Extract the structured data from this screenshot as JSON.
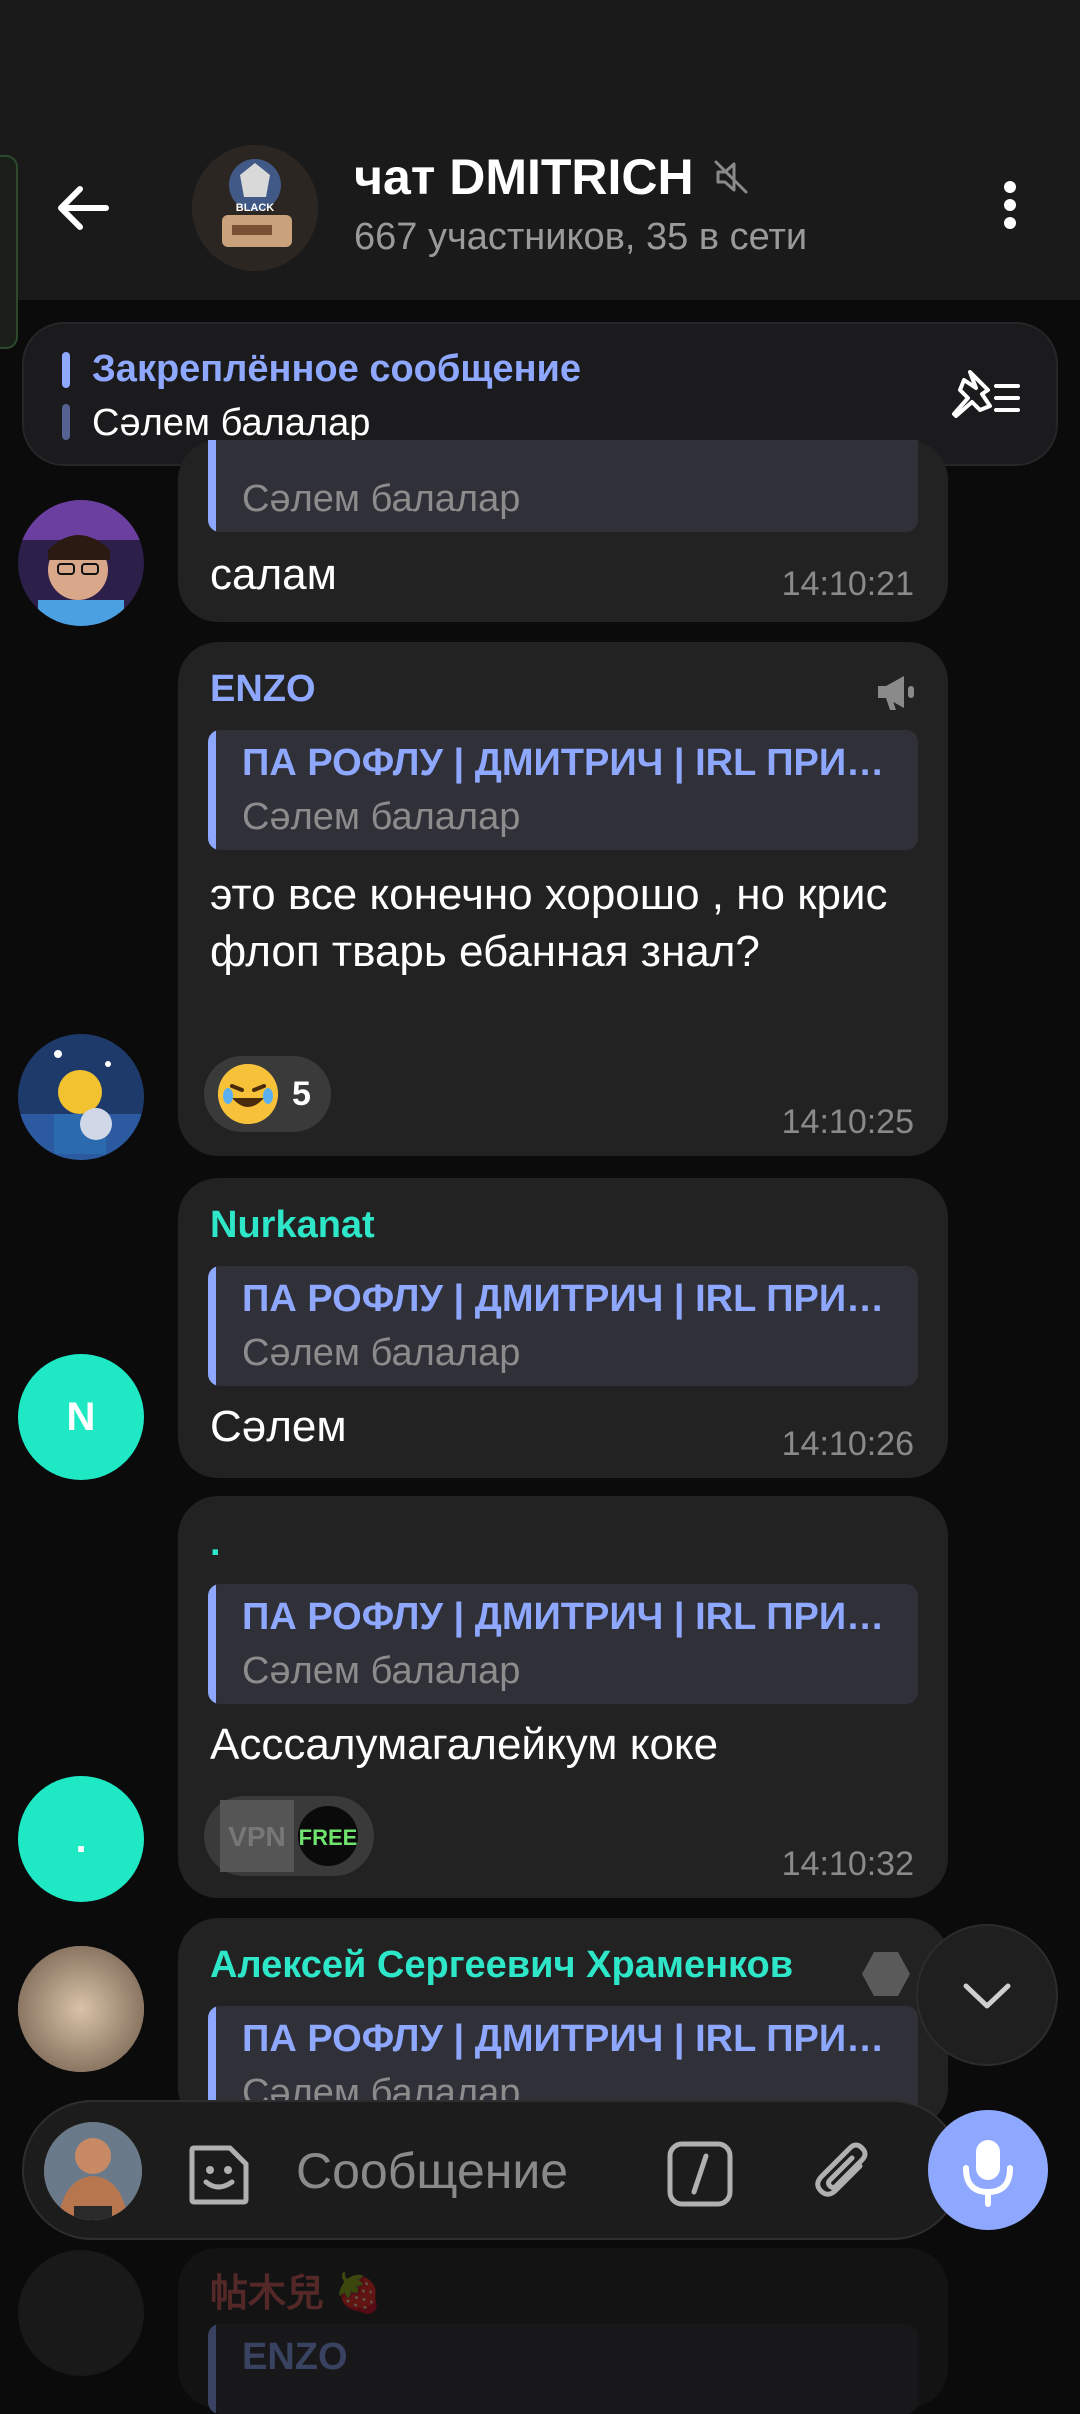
{
  "header": {
    "title": "чат DMITRICH",
    "subtitle": "667 участников, 35 в сети",
    "avatar_label": "BLACK"
  },
  "pinned": {
    "title": "Закреплённое сообщение",
    "text": "Сәлем балалар"
  },
  "messages": [
    {
      "sender": "",
      "quote_title": "",
      "quote_text": "Сәлем балалар",
      "text": "салам",
      "time": "14:10:21"
    },
    {
      "sender": "ENZO",
      "sender_color": "#8fa8ff",
      "quote_title": "ПА РОФЛУ | ДМИТРИЧ | IRL ПРИКОЛЫ",
      "quote_text": "Сәлем балалар",
      "text": "это все конечно хорошо , но крис флоп тварь ебанная знал?",
      "reaction_emoji": "rolling-laughing",
      "reaction_count": "5",
      "time": "14:10:25"
    },
    {
      "sender": "Nurkanat",
      "sender_color": "#2ee6c8",
      "avatar_letter": "N",
      "quote_title": "ПА РОФЛУ | ДМИТРИЧ | IRL ПРИКОЛЫ",
      "quote_text": "Сәлем балалар",
      "text": "Сәлем",
      "time": "14:10:26"
    },
    {
      "sender": ".",
      "sender_color": "#2ee6c8",
      "avatar_letter": ".",
      "quote_title": "ПА РОФЛУ | ДМИТРИЧ | IRL ПРИКОЛЫ",
      "quote_text": "Сәлем балалар",
      "text": "Асссалумагалейкум коке",
      "badge_left": "VPN",
      "badge_right": "FREE",
      "time": "14:10:32"
    },
    {
      "sender": "Алексей Сергеевич Храменков",
      "sender_color": "#2ee6c8",
      "quote_title": "ПА РОФЛУ | ДМИТРИЧ | IRL ПРИКОЛЫ",
      "quote_text": "Сәлем балалар"
    },
    {
      "sender": "帖木兒 🍓",
      "quote_title": "ENZO"
    }
  ],
  "input": {
    "placeholder": "Сообщение"
  },
  "colors": {
    "accent": "#8fa8ff",
    "teal": "#2ee6c8",
    "bubble": "#222222",
    "background": "#0b0b0b"
  }
}
